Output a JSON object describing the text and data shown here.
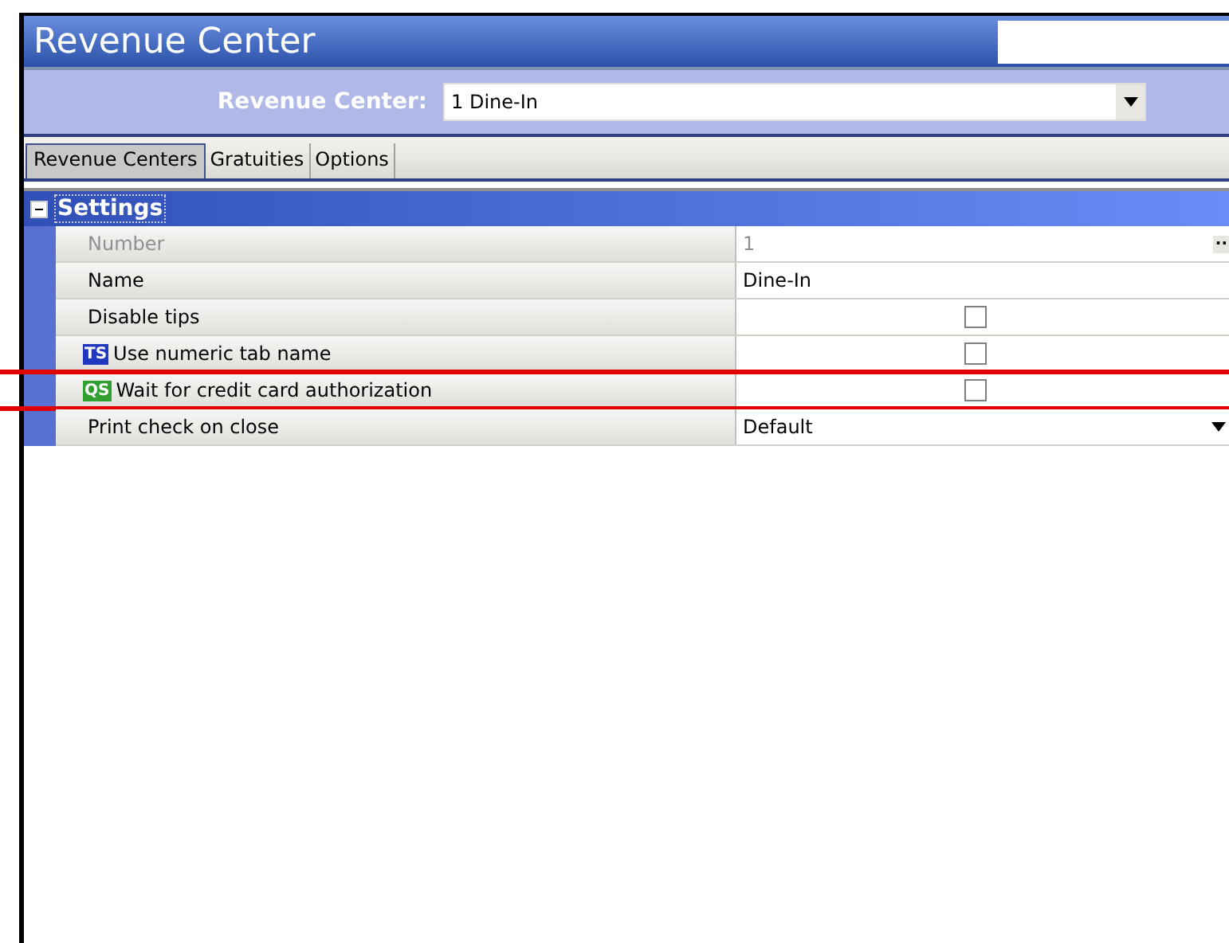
{
  "window": {
    "title": "Revenue Center"
  },
  "selector": {
    "label": "Revenue Center:",
    "value": "1 Dine-In"
  },
  "tabs": [
    {
      "label": "Revenue Centers",
      "selected": true
    },
    {
      "label": "Gratuities",
      "selected": false
    },
    {
      "label": "Options",
      "selected": false
    }
  ],
  "section": {
    "title": "Settings",
    "expanded": true
  },
  "rows": [
    {
      "kind": "text",
      "label": "Number",
      "value": "1",
      "disabled": true,
      "button": "··",
      "highlighted": false
    },
    {
      "kind": "text",
      "label": "Name",
      "value": "Dine-In",
      "disabled": false,
      "highlighted": false
    },
    {
      "kind": "checkbox",
      "label": "Disable tips",
      "checked": false,
      "disabled": false,
      "highlighted": false
    },
    {
      "kind": "checkbox",
      "label": "Use numeric tab name",
      "badge": "TS",
      "color": "#2038c0",
      "checked": false,
      "disabled": false,
      "highlighted": false
    },
    {
      "kind": "checkbox",
      "label": "Wait for credit card authorization",
      "badge": "QS",
      "color": "#30a030",
      "checked": false,
      "disabled": false,
      "highlighted": true
    },
    {
      "kind": "select",
      "label": "Print check on close",
      "value": "Default",
      "disabled": false,
      "highlighted": false
    }
  ]
}
